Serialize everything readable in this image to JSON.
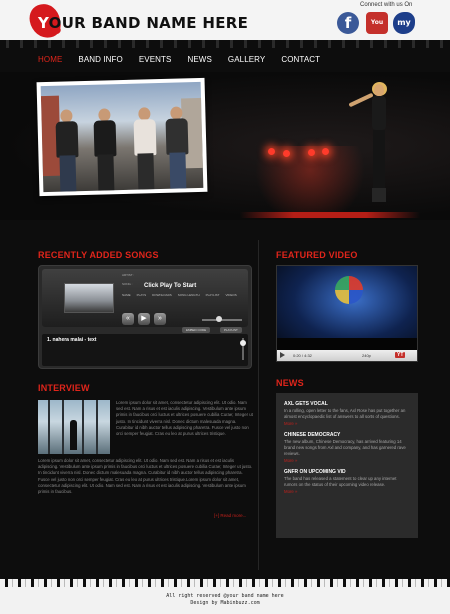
{
  "header": {
    "logo_initial": "Y",
    "logo_rest": "OUR BAND NAME HERE",
    "connect_label": "Connect with us On",
    "social": [
      {
        "name": "facebook-icon",
        "glyph": "f"
      },
      {
        "name": "youtube-icon",
        "glyph": "You Tube"
      },
      {
        "name": "myspace-icon",
        "glyph": "my"
      }
    ]
  },
  "nav": {
    "items": [
      {
        "label": "HOME",
        "active": true
      },
      {
        "label": "BAND INFO",
        "active": false
      },
      {
        "label": "EVENTS",
        "active": false
      },
      {
        "label": "NEWS",
        "active": false
      },
      {
        "label": "GALLERY",
        "active": false
      },
      {
        "label": "CONTACT",
        "active": false
      }
    ]
  },
  "songs": {
    "title": "RECENTLY ADDED SONGS",
    "player": {
      "artist_label": "ARTIST :",
      "song_label": "SONG :",
      "click_text": "Click Play To Start",
      "meta_labels": [
        "NAME",
        "PLAYS",
        "DOWNLOADS",
        "SONG LENGTH",
        "PLAYLIST",
        "VIDEOS"
      ],
      "embed_label": "EMBED CODE",
      "playlist_label": "PLAYLIST",
      "track": "1. nahera malai - text"
    }
  },
  "interview": {
    "title": "INTERVIEW",
    "text1": "Lorem ipsum dolor sit amet, consectetur adipiscing elit. Ut odio. Nam sed est. Nam a risus et est iaculis adipiscing. Vestibulum ante ipsum primis in faucibus orci luctus et ultrices posuere cubilia Curae; Integer ut justo. In tincidunt viverra nisl. Donec dictum malesuada magna. Curabitur id nibh auctor tellus adipiscing pharetra. Fusce vel justo non orci semper feugiat. Cras eu leo at purus ultrices tristique.",
    "text2": "Lorem ipsum dolor sit amet, consectetur adipiscing elit. Ut odio. Nam sed est. Nam a risus et est iaculis adipiscing. Vestibulum ante ipsum primis in faucibus orci luctus et ultrices posuere cubilia Curae; Integer ut justo. In tincidunt viverra nisl. Donec dictum malesuada magna. Curabitur id nibh auctor tellus adipiscing pharetra. Fusce vel justo non orci semper feugiat. Cras eu leo at purus ultrices tristique.Lorem ipsum dolor sit amet, consectetur adipiscing elit. Ut odio. Nam sed est. Nam a risus et est iaculis adipiscing. Vestibulum ante ipsum primis in faucibus.",
    "read_more": "[+] Read more..."
  },
  "video": {
    "title": "FEATURED VIDEO",
    "time": "0:20 / 4:32",
    "quality": "240p"
  },
  "news": {
    "title": "NEWS",
    "items": [
      {
        "title": "AXL GETS VOCAL",
        "body": "In a rolling, open letter to the fans, Axl Rose has put together an almost encyclopaedic list of answers to all sorts of questions.",
        "more": "More »"
      },
      {
        "title": "CHINESE DEMOCRACY",
        "body": "The new album, Chinese Democracy, has arrived featuring 14 brand new songs from Axl and company, and has garnered rave reviews.",
        "more": "More »"
      },
      {
        "title": "GNFR ON UPCOMING VID",
        "body": "The band has released a statement to clear up any internet rumors on the status of their upcoming video release.",
        "more": "More »"
      }
    ]
  },
  "footer": {
    "line1": "All right reserved @your band name here",
    "line2": "Design by Mabinbuzz.com"
  },
  "colors": {
    "accent": "#e0251b",
    "background_dark": "#0d0d0d",
    "news_box": "#2b2b2b"
  }
}
